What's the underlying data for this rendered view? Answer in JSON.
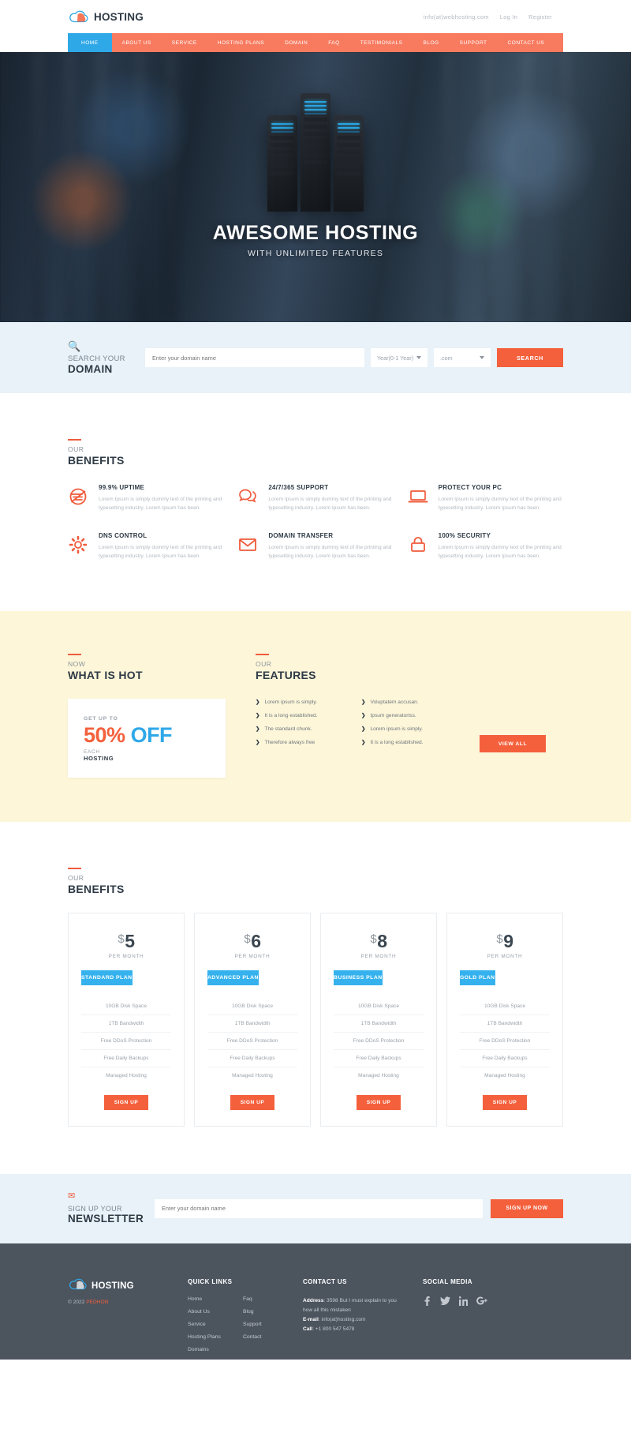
{
  "header": {
    "brand": "HOSTING",
    "logo_icon": "cloud-icon",
    "email": "info(at)webhosting.com",
    "login": "Log In",
    "register": "Register"
  },
  "nav": {
    "items": [
      {
        "label": "HOME",
        "active": true
      },
      {
        "label": "ABOUT US",
        "active": false
      },
      {
        "label": "SERVICE",
        "active": false
      },
      {
        "label": "HOSTING PLANS",
        "active": false
      },
      {
        "label": "DOMAIN",
        "active": false
      },
      {
        "label": "FAQ",
        "active": false
      },
      {
        "label": "TESTIMONIALS",
        "active": false
      },
      {
        "label": "BLOG",
        "active": false
      },
      {
        "label": "SUPPORT",
        "active": false
      },
      {
        "label": "CONTACT US",
        "active": false
      }
    ]
  },
  "hero": {
    "title": "AWESOME HOSTING",
    "subtitle": "WITH UNLIMITED FEATURES",
    "slide_count": 3,
    "active_slide": 1
  },
  "domain_search": {
    "icon": "search-icon",
    "line1": "SEARCH YOUR",
    "line2": "DOMAIN",
    "input_placeholder": "Enter your domain name",
    "input_value": "",
    "year_select": "Year(0-1 Year)",
    "tld_select": ".com",
    "button": "SEARCH"
  },
  "benefits": {
    "pre": "OUR",
    "title": "BENEFITS",
    "items": [
      {
        "icon": "speedometer-icon",
        "title": "99.9% UPTIME",
        "desc": "Lorem Ipsum is simply dummy text of the printing and typesetting industry. Lorem Ipsum has been."
      },
      {
        "icon": "chat-bubbles-icon",
        "title": "24/7/365 SUPPORT",
        "desc": "Lorem Ipsum is simply dummy text of the printing and typesetting industry. Lorem Ipsum has been."
      },
      {
        "icon": "laptop-icon",
        "title": "PROTECT YOUR PC",
        "desc": "Lorem Ipsum is simply dummy text of the printing and typesetting industry. Lorem Ipsum has been."
      },
      {
        "icon": "gear-icon",
        "title": "DNS CONTROL",
        "desc": "Lorem Ipsum is simply dummy text of the printing and typesetting industry. Lorem Ipsum has been."
      },
      {
        "icon": "envelope-icon",
        "title": "DOMAIN TRANSFER",
        "desc": "Lorem Ipsum is simply dummy text of the printing and typesetting industry. Lorem Ipsum has been."
      },
      {
        "icon": "lock-icon",
        "title": "100% SECURITY",
        "desc": "Lorem Ipsum is simply dummy text of the printing and typesetting industry. Lorem Ipsum has been."
      }
    ]
  },
  "hot": {
    "pre": "NOW",
    "title": "WHAT IS HOT",
    "card_pre": "GET UP TO",
    "card_percent": "50%",
    "card_off": "OFF",
    "card_each": "EACH",
    "card_hosting": "HOSTING"
  },
  "features": {
    "pre": "OUR",
    "title": "FEATURES",
    "col1": [
      "Lorem ipsum is simply.",
      "It is a long established.",
      "The standard chunk.",
      "Therefore always free"
    ],
    "col2": [
      "Voluptatem accusan.",
      "Ipsum generatortss.",
      "Lorem ipsum is simply.",
      "It is a long established."
    ],
    "view_all": "VIEW ALL"
  },
  "pricing": {
    "pre": "OUR",
    "title": "BENEFITS",
    "plans": [
      {
        "currency": "$",
        "price": "5",
        "per": "PER MONTH",
        "plan": "STANDARD PLAN",
        "features": [
          "10GB Disk Space",
          "1TB Bandwidth",
          "Free DDoS Protection",
          "Free Daily Backups",
          "Managed Hosting"
        ],
        "cta": "SIGN UP"
      },
      {
        "currency": "$",
        "price": "6",
        "per": "PER MONTH",
        "plan": "ADVANCED PLAN",
        "features": [
          "10GB Disk Space",
          "1TB Bandwidth",
          "Free DDoS Protection",
          "Free Daily Backups",
          "Managed Hosting"
        ],
        "cta": "SIGN UP"
      },
      {
        "currency": "$",
        "price": "8",
        "per": "PER MONTH",
        "plan": "BUSINESS PLAN",
        "features": [
          "10GB Disk Space",
          "1TB Bandwidth",
          "Free DDoS Protection",
          "Free Daily Backups",
          "Managed Hosting"
        ],
        "cta": "SIGN UP"
      },
      {
        "currency": "$",
        "price": "9",
        "per": "PER MONTH",
        "plan": "GOLD PLAN",
        "features": [
          "10GB Disk Space",
          "1TB Bandwidth",
          "Free DDoS Protection",
          "Free Daily Backups",
          "Managed Hosting"
        ],
        "cta": "SIGN UP"
      }
    ]
  },
  "newsletter": {
    "icon": "envelope-icon",
    "line1": "SIGN UP YOUR",
    "line2": "NEWSLETTER",
    "input_placeholder": "Enter your domain name",
    "input_value": "",
    "button": "SIGN UP NOW"
  },
  "footer": {
    "brand": "HOSTING",
    "copyright_year": "© 2022",
    "copyright_name": "PEDHON",
    "quick_links_heading": "QUICK LINKS",
    "quick_links_col1": [
      "Home",
      "About Us",
      "Service",
      "Hosting Plans",
      "Domains"
    ],
    "quick_links_col2": [
      "Faq",
      "Blog",
      "Support",
      "Contact"
    ],
    "contact_heading": "CONTACT US",
    "address_label": "Address",
    "address_value": ": 3598 But I must explain to you how all this mistaken",
    "email_label": "E-mail",
    "email_value": ": info(at)hosting.com",
    "call_label": "Call",
    "call_value": ": +1 800 547 5478",
    "social_heading": "SOCIAL MEDIA",
    "social": [
      {
        "icon": "facebook-icon",
        "glyph": "f"
      },
      {
        "icon": "twitter-icon",
        "glyph": "🐦"
      },
      {
        "icon": "linkedin-icon",
        "glyph": "in"
      },
      {
        "icon": "google-plus-icon",
        "glyph": "g+"
      }
    ]
  },
  "colors": {
    "accent_orange": "#f4603c",
    "nav_orange": "#f87a5f",
    "accent_blue": "#2fa8e8",
    "plan_blue": "#35b2ee",
    "pale_blue": "#e8f2f8",
    "pale_yellow": "#fdf6d9",
    "footer_grey": "#4c545e",
    "dark_text": "#2e3a45"
  }
}
